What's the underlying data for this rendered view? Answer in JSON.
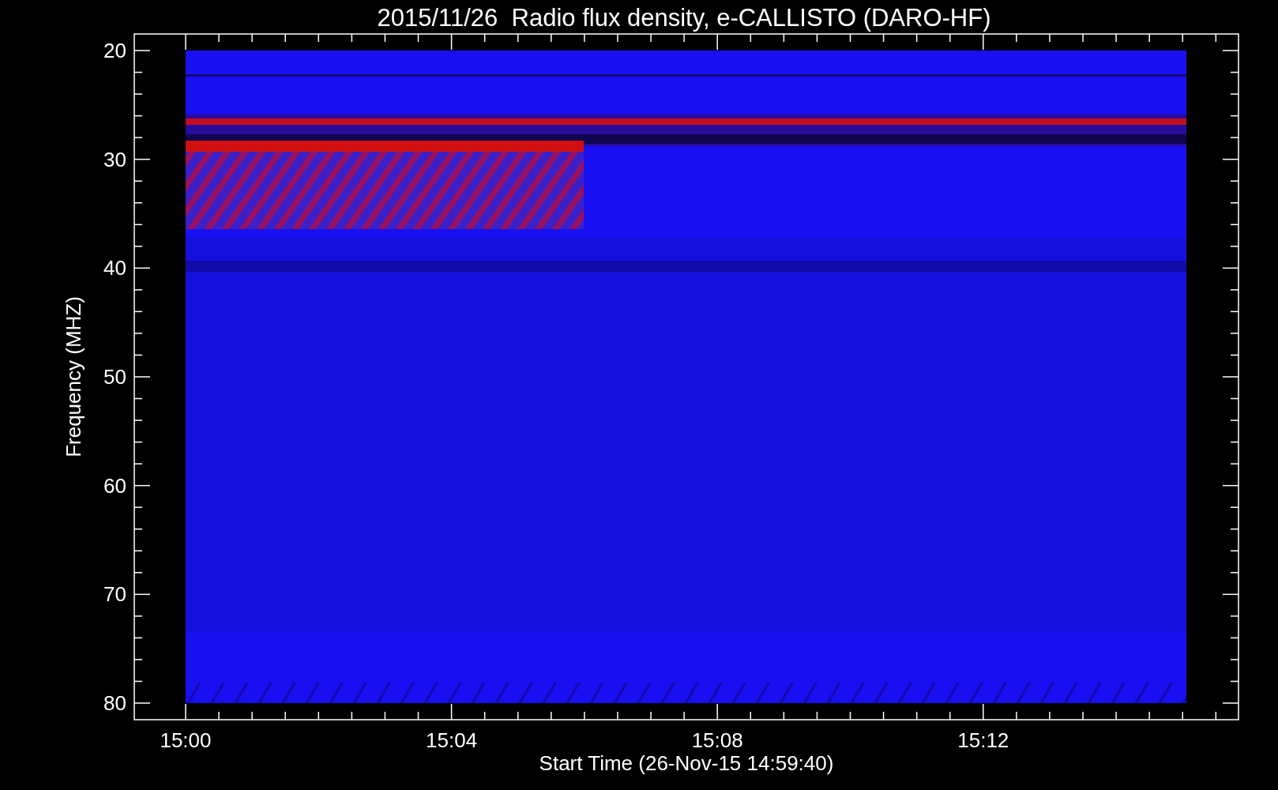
{
  "title": "2015/11/26  Radio flux density, e-CALLISTO (DARO-HF)",
  "y_axis": {
    "label": "Frequency (MHZ)",
    "ticks": [
      "20",
      "30",
      "40",
      "50",
      "60",
      "70",
      "80"
    ]
  },
  "x_axis": {
    "label": "Start Time (26-Nov-15 14:59:40)",
    "ticks": [
      "15:00",
      "15:04",
      "15:08",
      "15:12"
    ]
  }
}
